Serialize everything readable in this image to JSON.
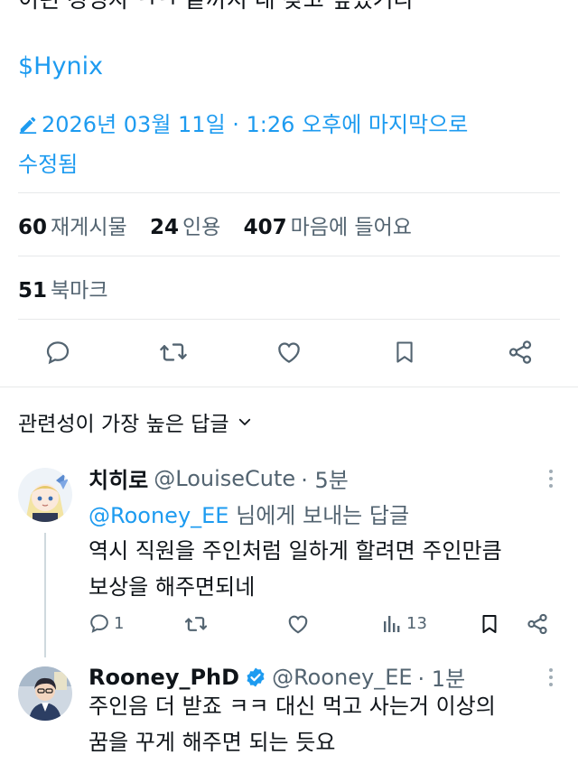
{
  "tweet": {
    "cut_top_text": "이런 경영자 ㅋㅋ 끝까지 내 갖고 싶었기다",
    "cashtag": "$Hynix",
    "edited_line1": "2026년 03월 11일 · 1:26 오후에 마지막으로",
    "edited_line2": "수정됨",
    "stats": {
      "reposts_count": "60",
      "reposts_label": "재게시물",
      "quotes_count": "24",
      "quotes_label": "인용",
      "likes_count": "407",
      "likes_label": "마음에 들어요",
      "bookmarks_count": "51",
      "bookmarks_label": "북마크"
    }
  },
  "replies_header": {
    "sort_label": "관련성이 가장 높은 답글"
  },
  "replies": [
    {
      "display_name": "치히로",
      "handle": "@LouiseCute",
      "time": "· 5분",
      "reply_to_mention": "@Rooney_EE",
      "reply_to_suffix": "님에게 보내는 답글",
      "text_line1": "역시 직원을 주인처럼 일하게 할려면 주인만큼",
      "text_line2": "보상을 해주면되네",
      "reply_count": "1",
      "view_count": "13"
    },
    {
      "display_name": "Rooney_PhD",
      "handle": "@Rooney_EE",
      "time": "· 1분",
      "text_line1": "주인음 더 받죠 ㅋㅋ 대신 먹고 사는거 이상의",
      "text_line2": "꿈을 꾸게 해주면 되는 듯요"
    }
  ],
  "colors": {
    "accent": "#1d9bf0",
    "secondary_text": "#536471",
    "divider": "#e7e9ea",
    "primary_text": "#0f1419"
  },
  "icons": [
    "pencil-icon",
    "reply-icon",
    "repost-icon",
    "like-icon",
    "bookmark-icon",
    "share-icon",
    "chevron-down-icon",
    "more-icon",
    "views-icon",
    "verified-badge-icon"
  ]
}
